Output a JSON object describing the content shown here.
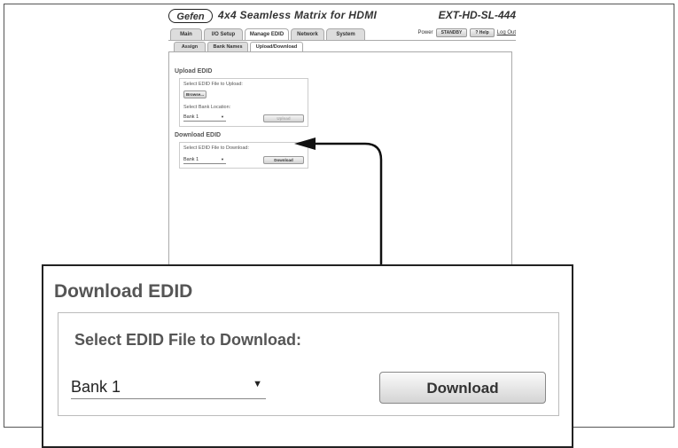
{
  "header": {
    "logo": "Gefen",
    "title": "4x4 Seamless Matrix for HDMI",
    "model": "EXT-HD-SL-444"
  },
  "main_tabs": [
    "Main",
    "I/O Setup",
    "Manage EDID",
    "Network",
    "System"
  ],
  "top_controls": {
    "power_label": "Power",
    "standby_button": "STANDBY",
    "help_button": "? Help",
    "logout_link": "Log Out"
  },
  "sub_tabs": [
    "Assign",
    "Bank Names",
    "Upload/Download"
  ],
  "upload": {
    "title": "Upload EDID",
    "file_label": "Select EDID File to Upload:",
    "browse_button": "Browse...",
    "bank_label": "Select Bank Location:",
    "bank_value": "Bank 1",
    "upload_button": "Upload"
  },
  "download": {
    "title": "Download EDID",
    "file_label": "Select EDID File to Download:",
    "bank_value": "Bank 1",
    "download_button": "Download"
  },
  "colors": {
    "accent": "#222222",
    "tab_bg": "#dddddd",
    "border": "#aaaaaa"
  },
  "icons": {
    "dropdown": "chevron-down-icon",
    "callout_arrow": "arrow-icon"
  }
}
